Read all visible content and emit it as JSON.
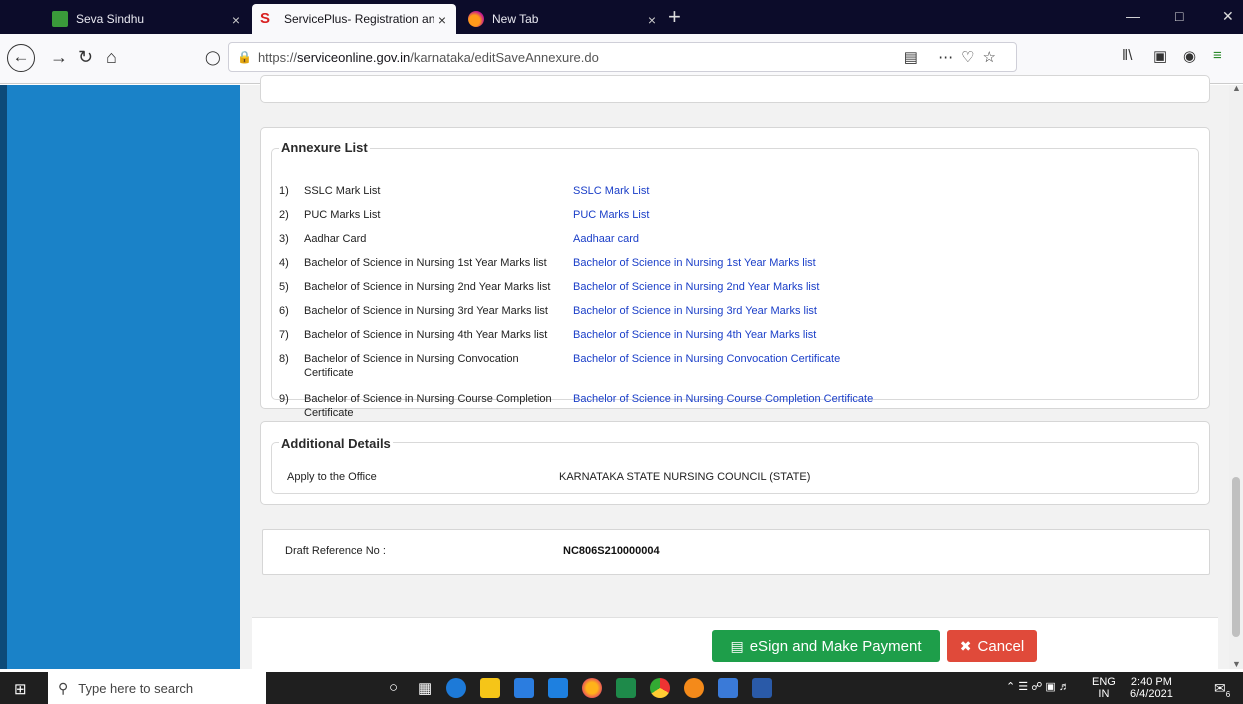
{
  "browser": {
    "tabs": [
      {
        "title": "Seva Sindhu",
        "close": "×"
      },
      {
        "title": "ServicePlus- Registration and V",
        "close": "×"
      },
      {
        "title": "New Tab",
        "close": "×"
      }
    ],
    "new_tab": "+",
    "url_prefix": "https://",
    "url_domain": "serviceonline.gov.in",
    "url_path": "/karnataka/editSaveAnnexure.do"
  },
  "annexure": {
    "legend": "Annexure List",
    "items": [
      {
        "num": "1)",
        "label": "SSLC Mark List",
        "link": "SSLC Mark List"
      },
      {
        "num": "2)",
        "label": "PUC Marks List",
        "link": "PUC Marks List"
      },
      {
        "num": "3)",
        "label": "Aadhar Card",
        "link": "Aadhaar card"
      },
      {
        "num": "4)",
        "label": "Bachelor of Science in Nursing 1st Year Marks list",
        "link": "Bachelor of Science in Nursing 1st Year Marks list"
      },
      {
        "num": "5)",
        "label": "Bachelor of Science in Nursing 2nd Year Marks list",
        "link": "Bachelor of Science in Nursing 2nd Year Marks list"
      },
      {
        "num": "6)",
        "label": "Bachelor of Science in Nursing 3rd Year Marks list",
        "link": "Bachelor of Science in Nursing 3rd Year Marks list"
      },
      {
        "num": "7)",
        "label": "Bachelor of Science in Nursing 4th Year Marks list",
        "link": "Bachelor of Science in Nursing 4th Year Marks list"
      },
      {
        "num": "8)",
        "label": "Bachelor of Science in Nursing Convocation Certificate",
        "link": "Bachelor of Science in Nursing Convocation Certificate"
      },
      {
        "num": "9)",
        "label": "Bachelor of Science in Nursing Course Completion Certificate",
        "link": "Bachelor of Science in Nursing Course Completion Certificate"
      }
    ]
  },
  "additional": {
    "legend": "Additional Details",
    "office_label": "Apply to the Office",
    "office_value": "KARNATAKA STATE NURSING COUNCIL (STATE)"
  },
  "draft": {
    "label": "Draft Reference No :",
    "value": "NC806S210000004"
  },
  "actions": {
    "esign_label": "eSign and Make Payment",
    "cancel_label": "Cancel"
  },
  "taskbar": {
    "search_placeholder": "Type here to search",
    "lang_top": "ENG",
    "lang_bottom": "IN",
    "time": "2:40 PM",
    "date": "6/4/2021",
    "notification_count": "6"
  },
  "colors": {
    "sidebar": "#1a82c8",
    "link": "#1a3ec8",
    "esign_button": "#1e9e4a",
    "cancel_button": "#e04a3a"
  }
}
